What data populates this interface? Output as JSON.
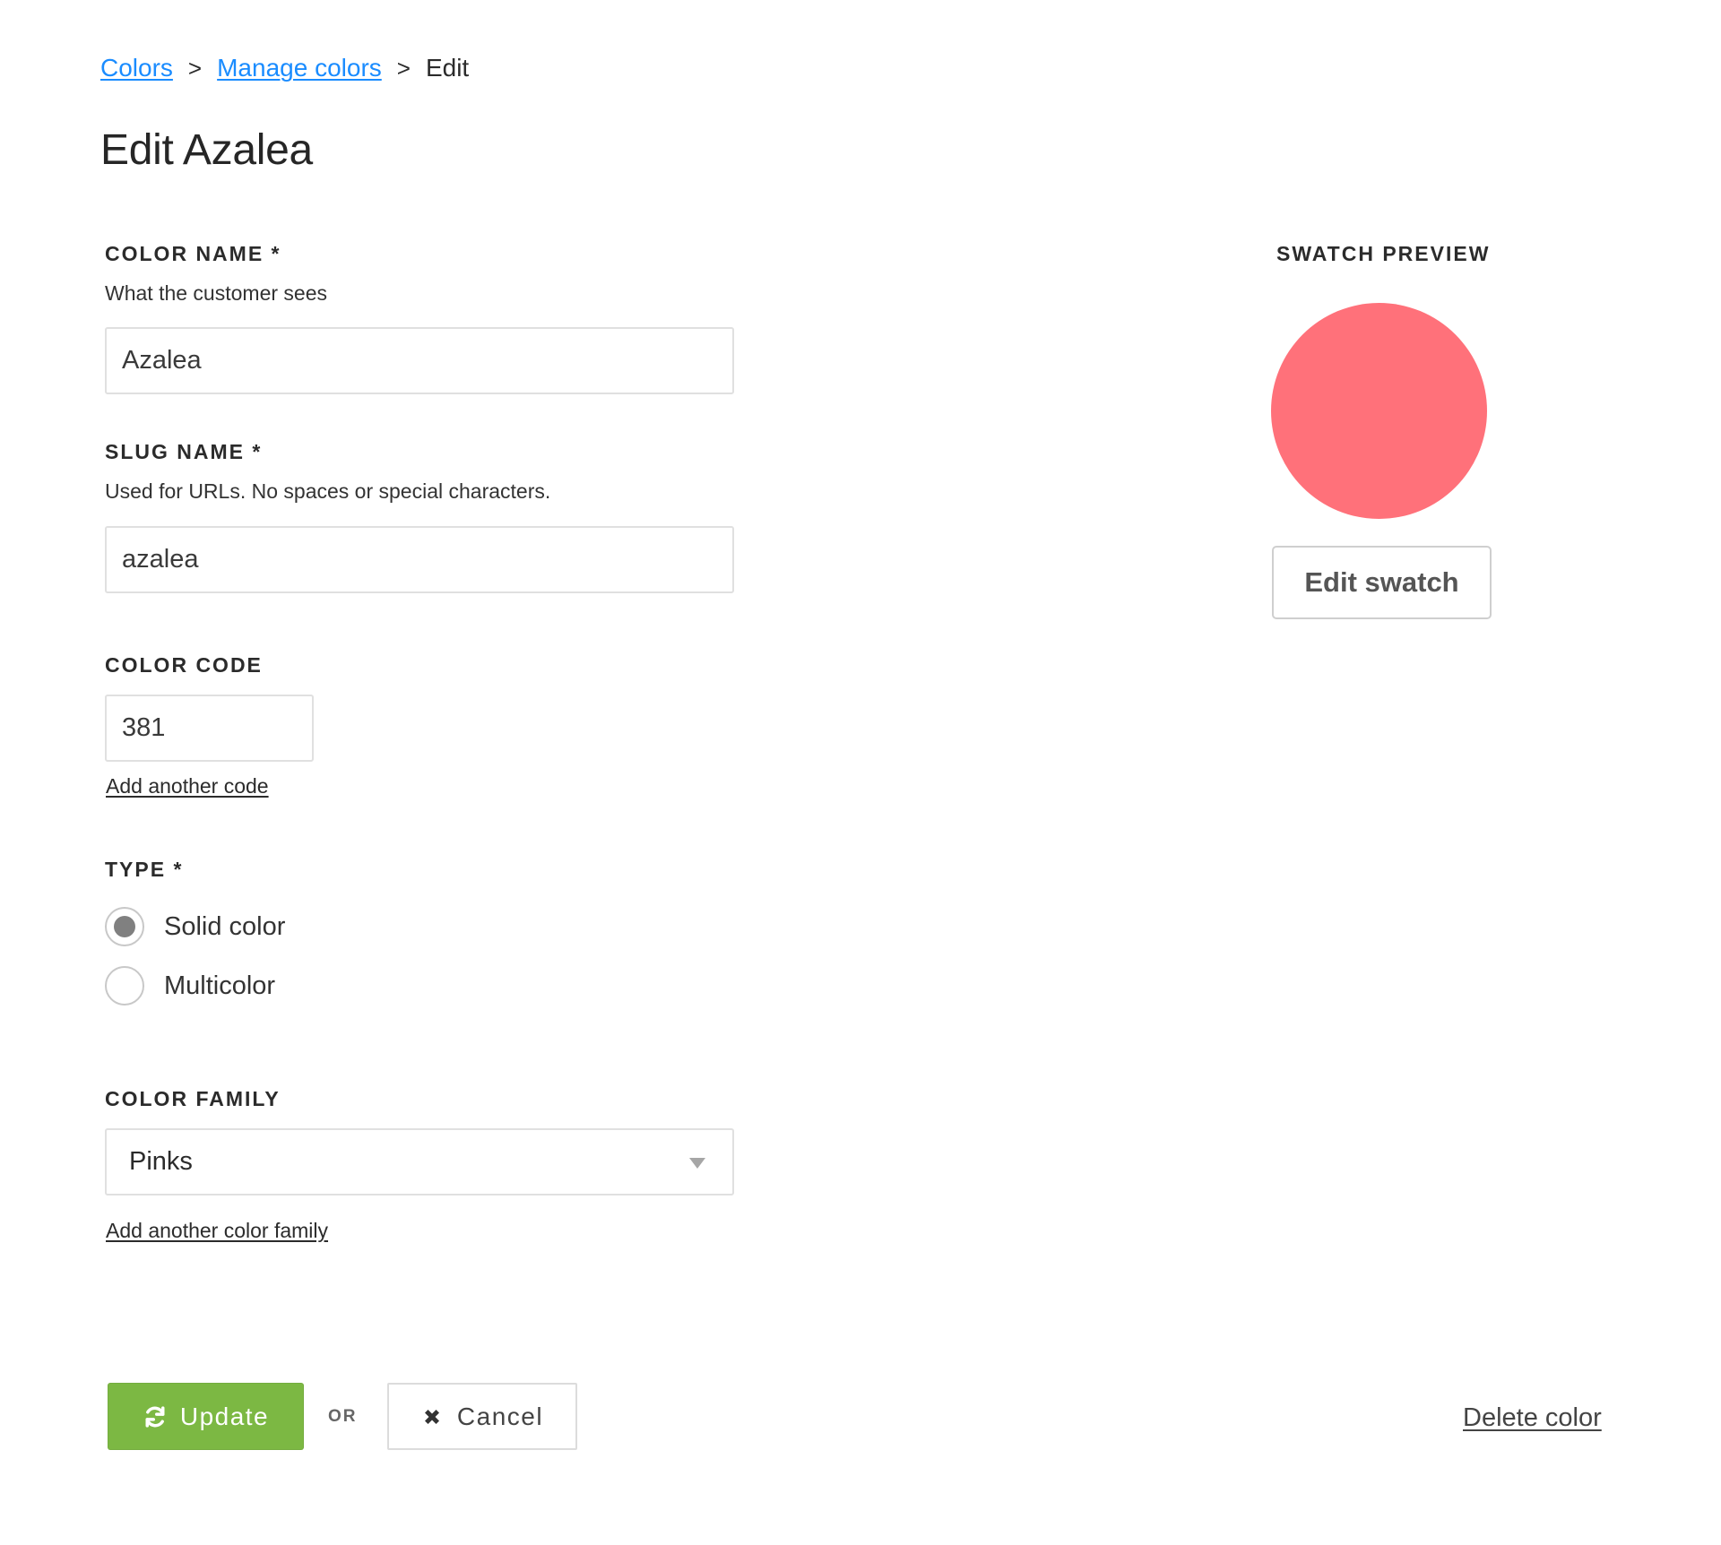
{
  "breadcrumb": {
    "items": [
      {
        "label": "Colors",
        "link": true
      },
      {
        "label": "Manage colors",
        "link": true
      },
      {
        "label": "Edit",
        "link": false
      }
    ],
    "separator": ">"
  },
  "page_title": "Edit Azalea",
  "form": {
    "color_name": {
      "label": "COLOR NAME *",
      "helper": "What the customer sees",
      "value": "Azalea"
    },
    "slug_name": {
      "label": "SLUG NAME *",
      "helper": "Used for URLs. No spaces or special characters.",
      "value": "azalea"
    },
    "color_code": {
      "label": "COLOR CODE",
      "value": "381",
      "add_link": "Add another code"
    },
    "type": {
      "label": "TYPE *",
      "options": [
        {
          "label": "Solid color",
          "checked": true
        },
        {
          "label": "Multicolor",
          "checked": false
        }
      ]
    },
    "color_family": {
      "label": "COLOR FAMILY",
      "selected": "Pinks",
      "add_link": "Add another color family"
    }
  },
  "swatch": {
    "label": "SWATCH PREVIEW",
    "color": "#ff717a",
    "edit_button": "Edit swatch"
  },
  "actions": {
    "update_label": "Update",
    "update_icon": "refresh-icon",
    "update_color": "#7cb843",
    "or_label": "OR",
    "cancel_label": "Cancel",
    "cancel_icon": "close-icon",
    "delete_label": "Delete color"
  }
}
